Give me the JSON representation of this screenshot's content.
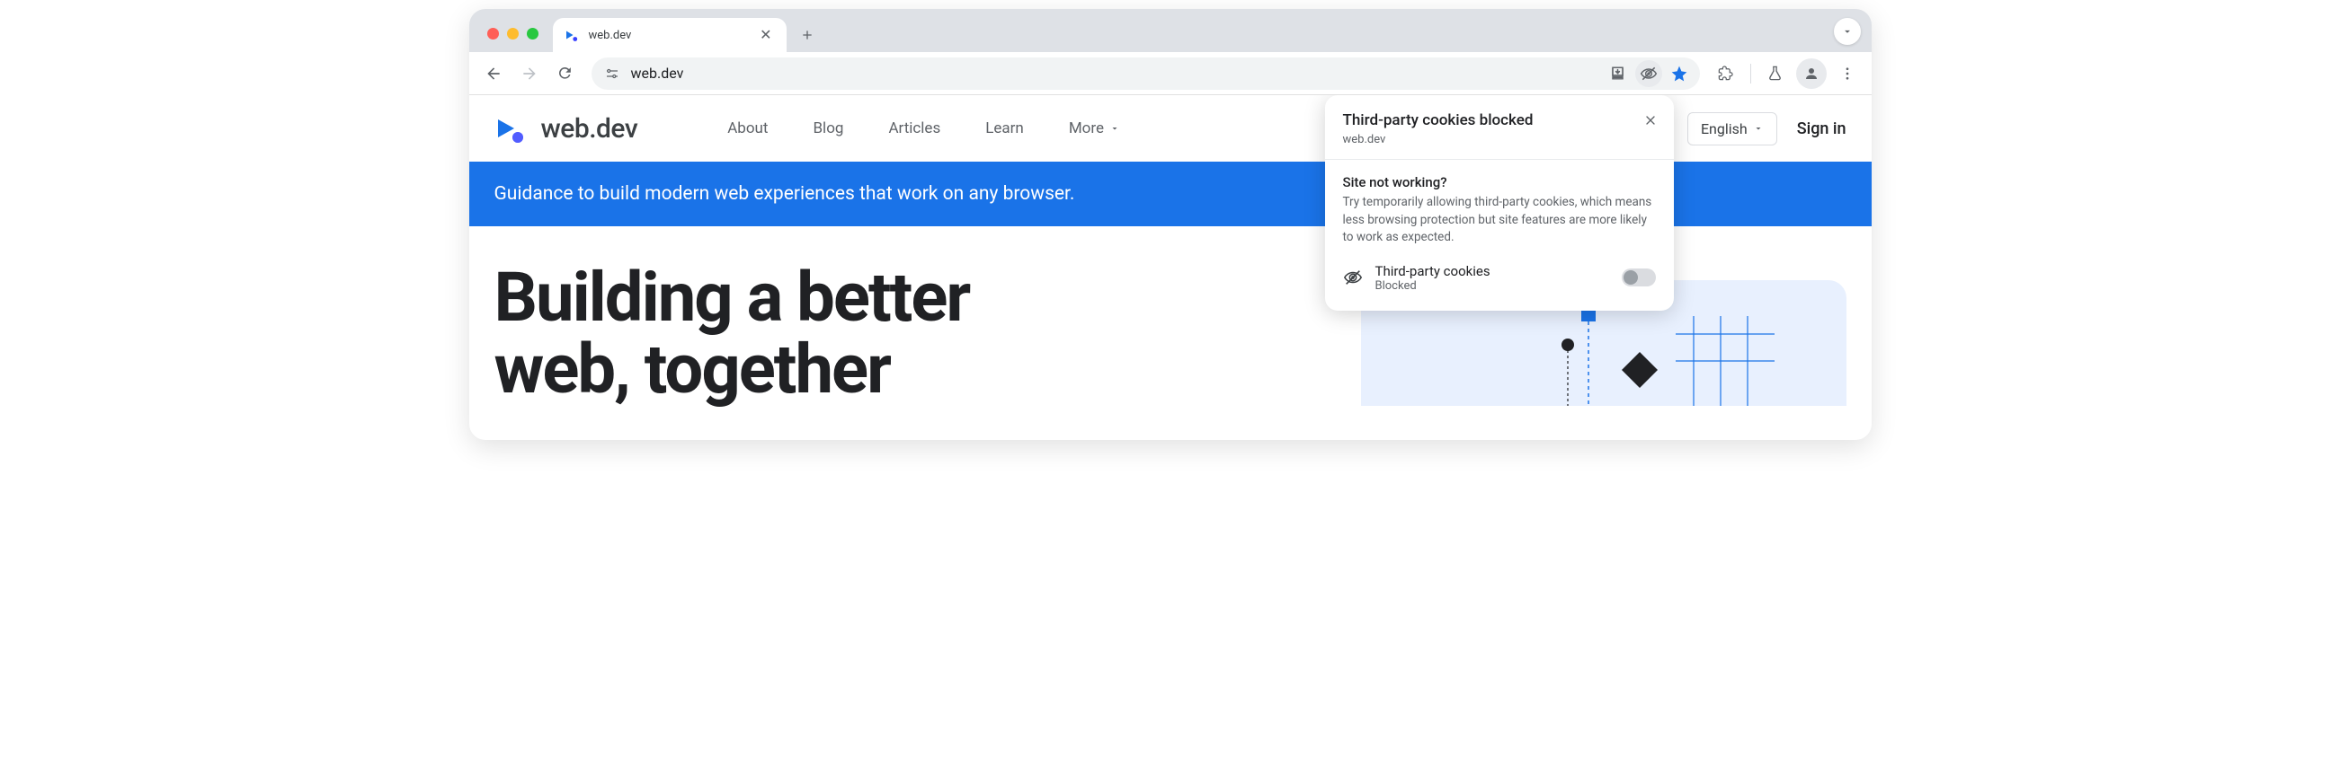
{
  "browser": {
    "tab_title": "web.dev",
    "url": "web.dev"
  },
  "site": {
    "logo_text": "web.dev",
    "nav": {
      "about": "About",
      "blog": "Blog",
      "articles": "Articles",
      "learn": "Learn",
      "more": "More"
    },
    "language": "English",
    "signin": "Sign in",
    "banner": "Guidance to build modern web experiences that work on any browser.",
    "hero_line1": "Building a better",
    "hero_line2": "web, together"
  },
  "popup": {
    "title": "Third-party cookies blocked",
    "site": "web.dev",
    "question": "Site not working?",
    "description": "Try temporarily allowing third-party cookies, which means less browsing protection but site features are more likely to work as expected.",
    "cookie_label": "Third-party cookies",
    "cookie_status": "Blocked"
  }
}
